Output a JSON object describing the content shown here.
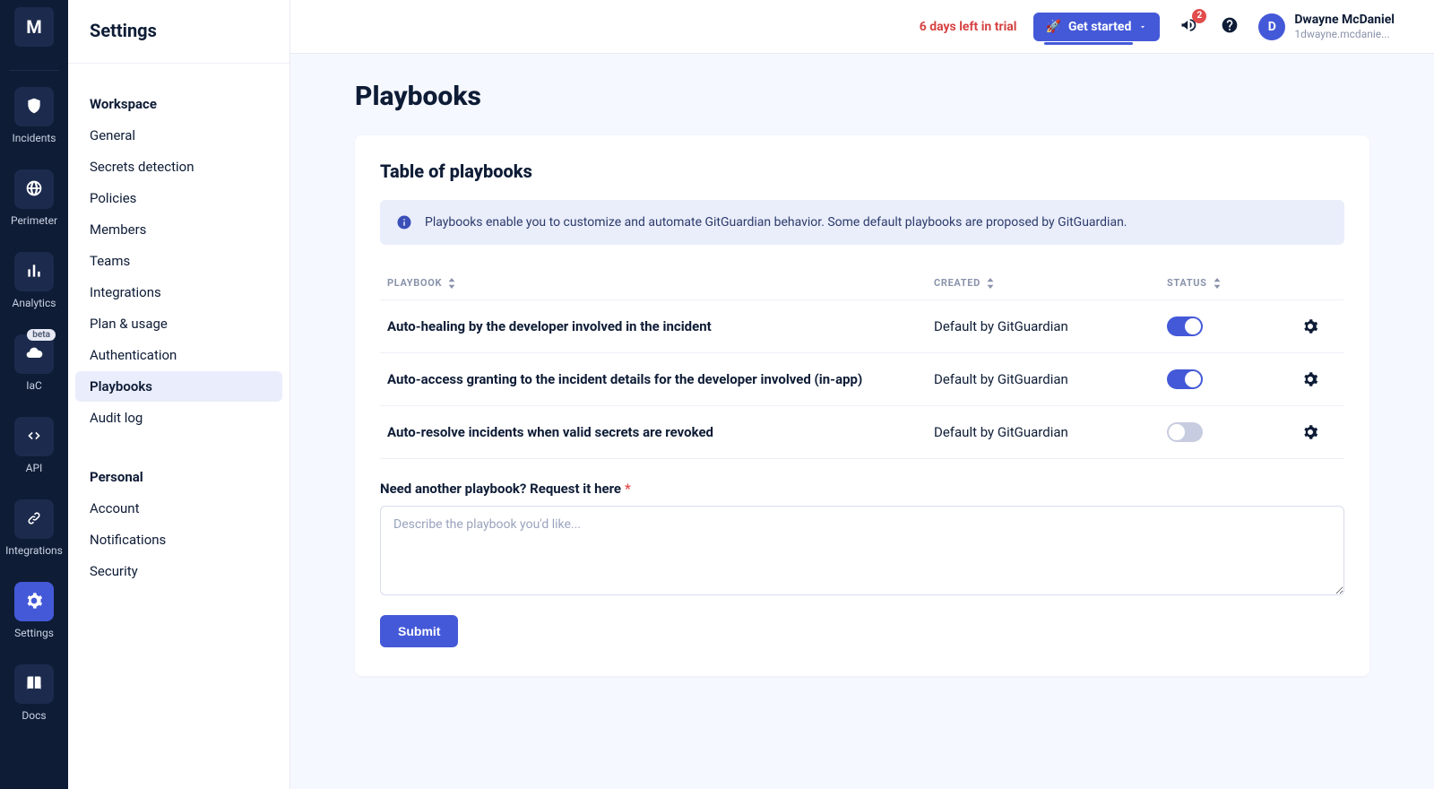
{
  "brand": {
    "logo_letter": "M"
  },
  "rail_items": [
    {
      "id": "incidents",
      "label": "Incidents",
      "icon": "shield"
    },
    {
      "id": "perimeter",
      "label": "Perimeter",
      "icon": "globe"
    },
    {
      "id": "analytics",
      "label": "Analytics",
      "icon": "bar-chart"
    },
    {
      "id": "iac",
      "label": "IaC",
      "icon": "cloud",
      "badge": "beta"
    },
    {
      "id": "api",
      "label": "API",
      "icon": "code"
    },
    {
      "id": "integrations",
      "label": "Integrations",
      "icon": "link"
    },
    {
      "id": "settings",
      "label": "Settings",
      "icon": "gear",
      "active": true
    },
    {
      "id": "docs",
      "label": "Docs",
      "icon": "book"
    }
  ],
  "sidebar": {
    "title": "Settings",
    "sections": [
      {
        "label": "Workspace",
        "items": [
          {
            "id": "general",
            "label": "General"
          },
          {
            "id": "secrets-detection",
            "label": "Secrets detection"
          },
          {
            "id": "policies",
            "label": "Policies"
          },
          {
            "id": "members",
            "label": "Members"
          },
          {
            "id": "teams",
            "label": "Teams"
          },
          {
            "id": "integrations",
            "label": "Integrations"
          },
          {
            "id": "plan-usage",
            "label": "Plan & usage"
          },
          {
            "id": "authentication",
            "label": "Authentication"
          },
          {
            "id": "playbooks",
            "label": "Playbooks",
            "active": true
          },
          {
            "id": "audit-log",
            "label": "Audit log"
          }
        ]
      },
      {
        "label": "Personal",
        "items": [
          {
            "id": "account",
            "label": "Account"
          },
          {
            "id": "notifications",
            "label": "Notifications"
          },
          {
            "id": "security",
            "label": "Security"
          }
        ]
      }
    ]
  },
  "topbar": {
    "trial_text": "6 days left in trial",
    "get_started_label": "Get started",
    "rocket": "🚀",
    "notification_count": "2",
    "user": {
      "initial": "D",
      "name": "Dwayne McDaniel",
      "email": "1dwayne.mcdanie..."
    }
  },
  "page": {
    "title": "Playbooks",
    "card_title": "Table of playbooks",
    "banner_text": "Playbooks enable you to customize and automate GitGuardian behavior. Some default playbooks are proposed by GitGuardian.",
    "columns": {
      "name": "PLAYBOOK",
      "created": "CREATED",
      "status": "STATUS"
    },
    "rows": [
      {
        "name": "Auto-healing by the developer involved in the incident",
        "created": "Default by GitGuardian",
        "on": true
      },
      {
        "name": "Auto-access granting to the incident details for the developer involved (in-app)",
        "created": "Default by GitGuardian",
        "on": true
      },
      {
        "name": "Auto-resolve incidents when valid secrets are revoked",
        "created": "Default by GitGuardian",
        "on": false
      }
    ],
    "request_label": "Need another playbook? Request it here",
    "request_placeholder": "Describe the playbook you'd like...",
    "submit_label": "Submit"
  }
}
